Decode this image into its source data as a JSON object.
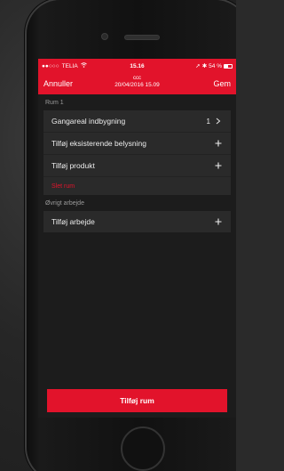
{
  "status_bar": {
    "carrier": "TELIA",
    "time": "15.16",
    "battery_text": "54 %",
    "battery_level": 0.54
  },
  "nav": {
    "cancel_label": "Annuller",
    "title": "ccc",
    "subtitle": "20/04/2016 15.09",
    "save_label": "Gem"
  },
  "sections": [
    {
      "header": "Rum 1",
      "rows": [
        {
          "label": "Gangareal indbygning",
          "value": "1"
        },
        {
          "label": "Tilføj eksisterende belysning"
        },
        {
          "label": "Tilføj produkt"
        }
      ],
      "delete_label": "Slet rum"
    },
    {
      "header": "Øvrigt arbejde",
      "rows": [
        {
          "label": "Tilføj arbejde"
        }
      ]
    }
  ],
  "primary_button_label": "Tilføj rum",
  "colors": {
    "accent": "#e2132b",
    "background": "#1c1c1c",
    "cell": "#2a2a2a"
  }
}
